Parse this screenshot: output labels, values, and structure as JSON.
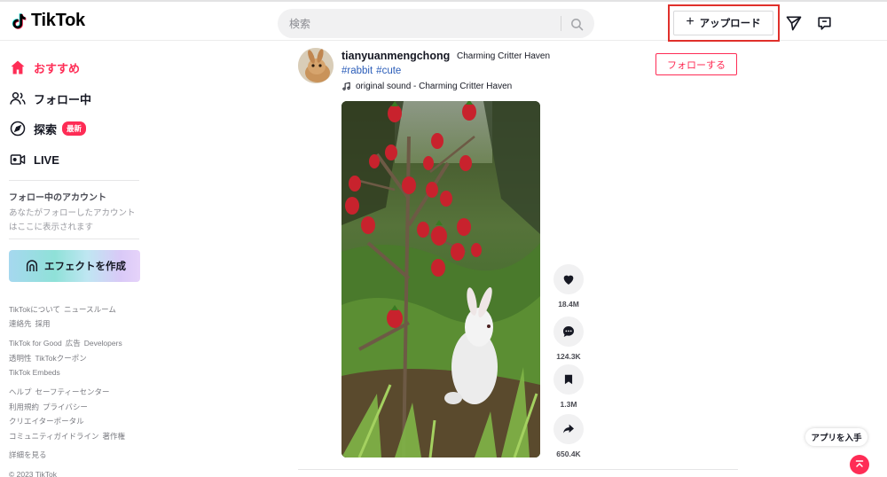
{
  "header": {
    "logo_text": "TikTok",
    "search_placeholder": "検索",
    "upload_label": "アップロード"
  },
  "sidebar": {
    "nav": [
      {
        "label": "おすすめ",
        "icon": "home-icon",
        "active": true
      },
      {
        "label": "フォロー中",
        "icon": "users-icon"
      },
      {
        "label": "探索",
        "icon": "compass-icon",
        "badge": "最新"
      },
      {
        "label": "LIVE",
        "icon": "live-icon"
      }
    ],
    "following_title": "フォロー中のアカウント",
    "following_desc": "あなたがフォローしたアカウントはここに表示されます",
    "effect_label": "エフェクトを作成",
    "footer": {
      "row1": [
        "TikTokについて",
        "ニュースルーム"
      ],
      "row2": [
        "連絡先",
        "採用"
      ],
      "row3": [
        "TikTok for Good",
        "広告",
        "Developers"
      ],
      "row4": [
        "透明性",
        "TikTokクーポン"
      ],
      "row5": [
        "TikTok Embeds"
      ],
      "row6": [
        "ヘルプ",
        "セーフティーセンター"
      ],
      "row7": [
        "利用規約",
        "プライバシー"
      ],
      "row8": [
        "クリエイターポータル"
      ],
      "row9": [
        "コミュニティガイドライン",
        "著作権"
      ],
      "row10": [
        "詳細を見る"
      ],
      "copyright": "© 2023 TikTok"
    }
  },
  "post": {
    "username": "tianyuanmengchong",
    "nickname": "Charming Critter Haven",
    "tags": [
      "#rabbit",
      "#cute"
    ],
    "sound": "original sound - Charming Critter Haven",
    "follow_label": "フォローする",
    "actions": {
      "likes": "18.4M",
      "comments": "124.3K",
      "saves": "1.3M",
      "shares": "650.4K"
    }
  },
  "floating": {
    "get_app_label": "アプリを入手"
  },
  "colors": {
    "brand": "#fe2c55",
    "tag": "#2b5db9",
    "highlight": "#e0302b"
  }
}
